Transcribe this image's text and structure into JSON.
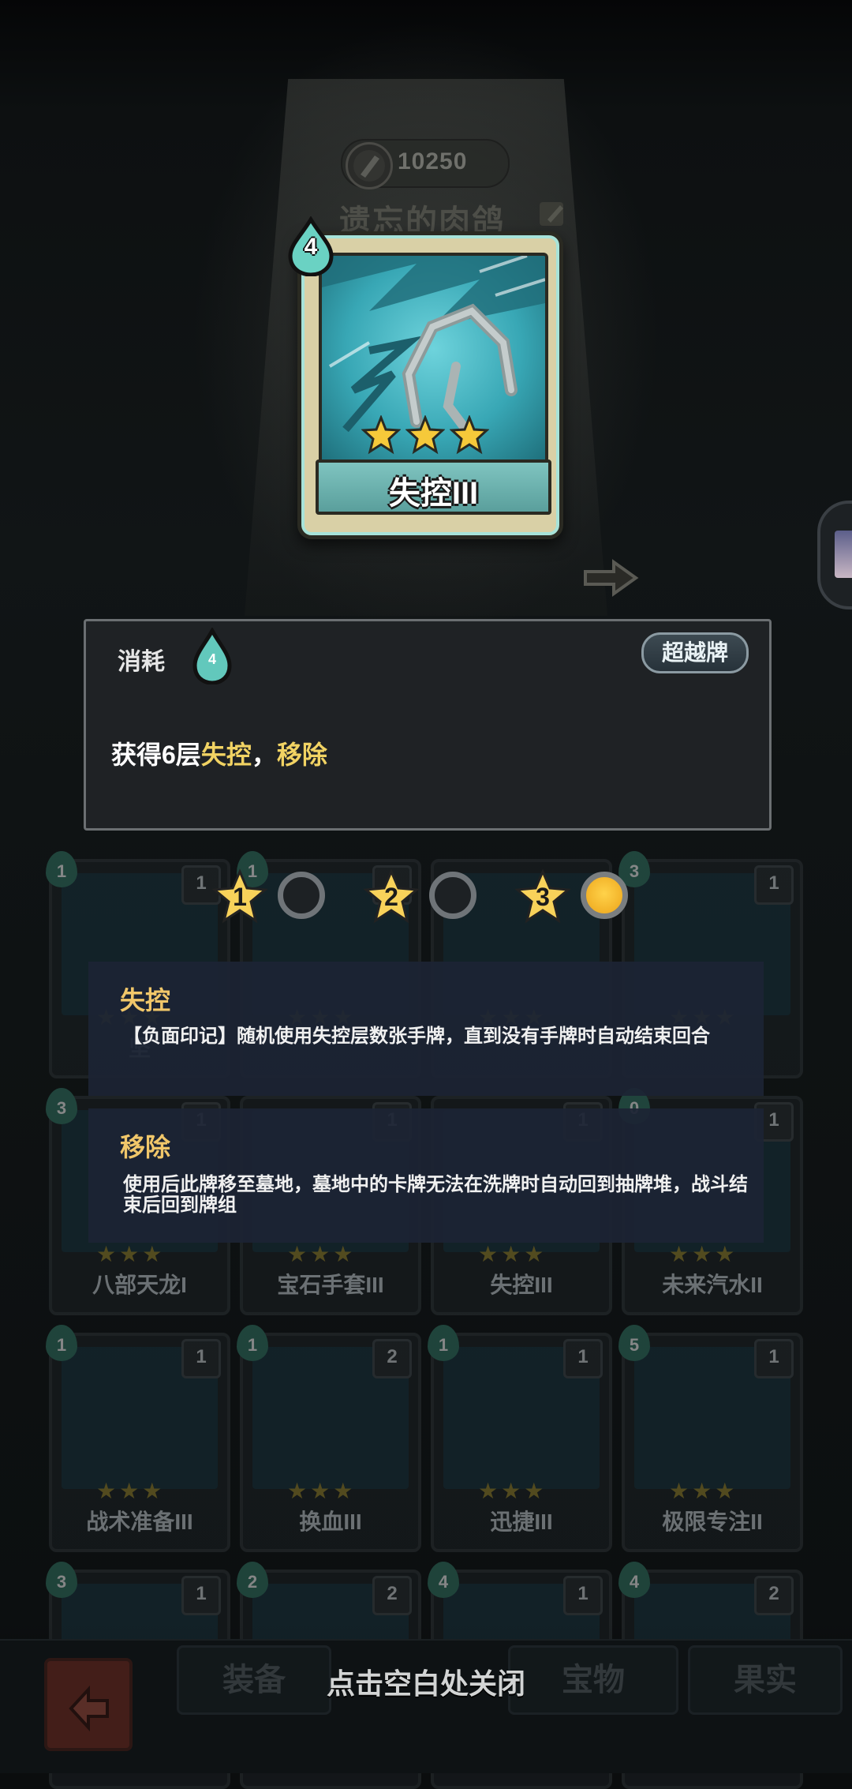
{
  "header": {
    "coins": "10250",
    "hero_name": "遗忘的肉鸽"
  },
  "card": {
    "cost": "4",
    "name": "失控III",
    "stars": 3
  },
  "description": {
    "cost_label": "消耗",
    "cost_value": "4",
    "tag": "超越牌",
    "text_prefix": "获得6层",
    "keyword1": "失控",
    "separator": "，",
    "keyword2": "移除"
  },
  "levels": [
    {
      "num": "1",
      "selected": false
    },
    {
      "num": "2",
      "selected": false
    },
    {
      "num": "3",
      "selected": true
    }
  ],
  "keywords": [
    {
      "title": "失控",
      "body": "【负面印记】随机使用失控层数张手牌，直到没有手牌时自动结束回合"
    },
    {
      "title": "移除",
      "body": "使用后此牌移至墓地，墓地中的卡牌无法在洗牌时自动回到抽牌堆，战斗结束后回到牌组"
    }
  ],
  "deck": [
    {
      "name": "坚",
      "cost": "1",
      "count": "1"
    },
    {
      "name": "",
      "cost": "1",
      "count": "1"
    },
    {
      "name": "",
      "cost": "",
      "count": ""
    },
    {
      "name": "",
      "cost": "3",
      "count": "1"
    },
    {
      "name": "八部天龙I",
      "cost": "3",
      "count": "1"
    },
    {
      "name": "宝石手套III",
      "cost": "",
      "count": "1"
    },
    {
      "name": "失控III",
      "cost": "",
      "count": "1"
    },
    {
      "name": "未来汽水II",
      "cost": "0",
      "count": "1"
    },
    {
      "name": "战术准备III",
      "cost": "1",
      "count": "1"
    },
    {
      "name": "换血III",
      "cost": "1",
      "count": "2"
    },
    {
      "name": "迅捷III",
      "cost": "1",
      "count": "1"
    },
    {
      "name": "极限专注II",
      "cost": "5",
      "count": "1"
    },
    {
      "name": "",
      "cost": "3",
      "count": "1"
    },
    {
      "name": "",
      "cost": "2",
      "count": "2"
    },
    {
      "name": "",
      "cost": "4",
      "count": "1"
    },
    {
      "name": "",
      "cost": "4",
      "count": "2"
    }
  ],
  "bottom": {
    "tabs": [
      "装备",
      "宝物",
      "果实"
    ],
    "close_hint": "点击空白处关闭"
  },
  "colors": {
    "keyword": "#f1d363",
    "kw_title": "#f1c76a",
    "card_frame": "#d9d0a6",
    "art_cyan": "#38a7b5"
  }
}
